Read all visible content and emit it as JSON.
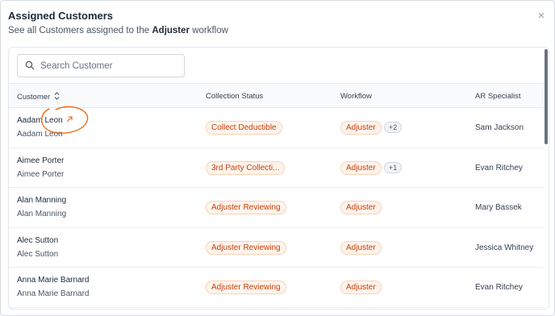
{
  "modal": {
    "title": "Assigned Customers",
    "subtitle_prefix": "See all Customers assigned to the ",
    "subtitle_bold": "Adjuster",
    "subtitle_suffix": " workflow",
    "close_icon": "×"
  },
  "search": {
    "placeholder": "Search Customer",
    "value": ""
  },
  "table": {
    "headers": {
      "customer": "Customer",
      "status": "Collection Status",
      "workflow": "Workflow",
      "ar": "AR Specialist"
    },
    "rows": [
      {
        "name": "Aadam Leon",
        "sub": "Aadam Leon",
        "status": "Collect Deductible",
        "workflow": "Adjuster",
        "extra": "+2",
        "ar": "Sam Jackson"
      },
      {
        "name": "Aimee Porter",
        "sub": "Aimee Porter",
        "status": "3rd Party Collecti...",
        "workflow": "Adjuster",
        "extra": "+1",
        "ar": "Evan Ritchey"
      },
      {
        "name": "Alan Manning",
        "sub": "Alan Manning",
        "status": "Adjuster Reviewing",
        "workflow": "Adjuster",
        "extra": "",
        "ar": "Mary Bassek"
      },
      {
        "name": "Alec Sutton",
        "sub": "Alec Sutton",
        "status": "Adjuster Reviewing",
        "workflow": "Adjuster",
        "extra": "",
        "ar": "Jessica Whitney"
      },
      {
        "name": "Anna Marie Barnard",
        "sub": "Anna Marie Barnard",
        "status": "Adjuster Reviewing",
        "workflow": "Adjuster",
        "extra": "",
        "ar": "Evan Ritchey"
      }
    ]
  },
  "icons": {
    "search": "search-icon",
    "sort": "sort-updown-icon",
    "external_link": "external-link-arrow-icon",
    "close": "close-icon"
  },
  "colors": {
    "accent": "#e8630a",
    "pill_text": "#c2410c",
    "pill_bg": "#fff4ec",
    "pill_border": "#f7d2b6"
  }
}
